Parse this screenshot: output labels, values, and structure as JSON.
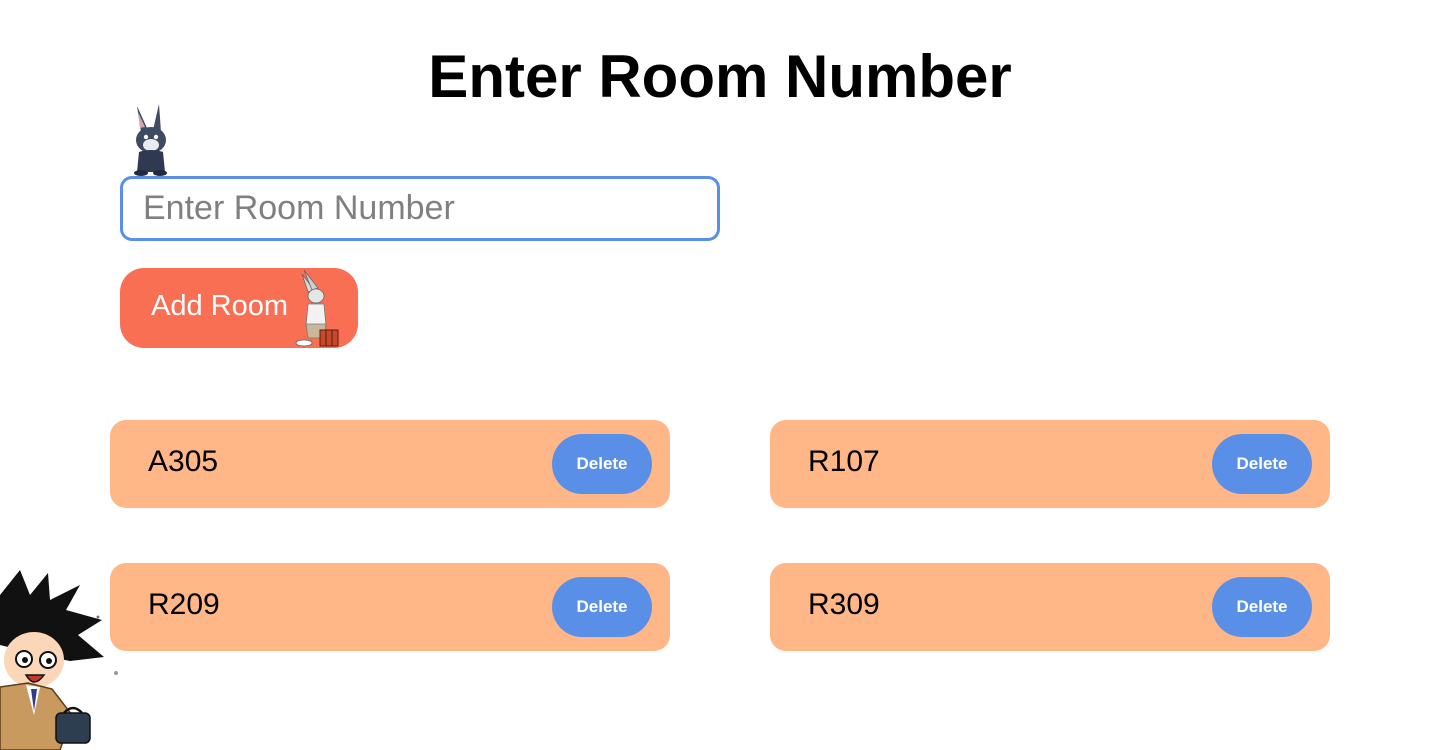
{
  "header": {
    "title": "Enter Room Number"
  },
  "form": {
    "input_placeholder": "Enter Room Number",
    "input_value": "",
    "add_button_label": "Add Room"
  },
  "rooms": [
    {
      "name": "A305",
      "delete_label": "Delete"
    },
    {
      "name": "R107",
      "delete_label": "Delete"
    },
    {
      "name": "R209",
      "delete_label": "Delete"
    },
    {
      "name": "R309",
      "delete_label": "Delete"
    }
  ],
  "stickers": {
    "top": "bunny-sticker-icon",
    "button": "bugs-bunny-sticker-icon",
    "corner": "anime-boy-sticker-icon"
  },
  "colors": {
    "input_border": "#5b8ee6",
    "add_button": "#f96f54",
    "card_background": "#ffb787",
    "delete_button": "#5a8fe8"
  }
}
